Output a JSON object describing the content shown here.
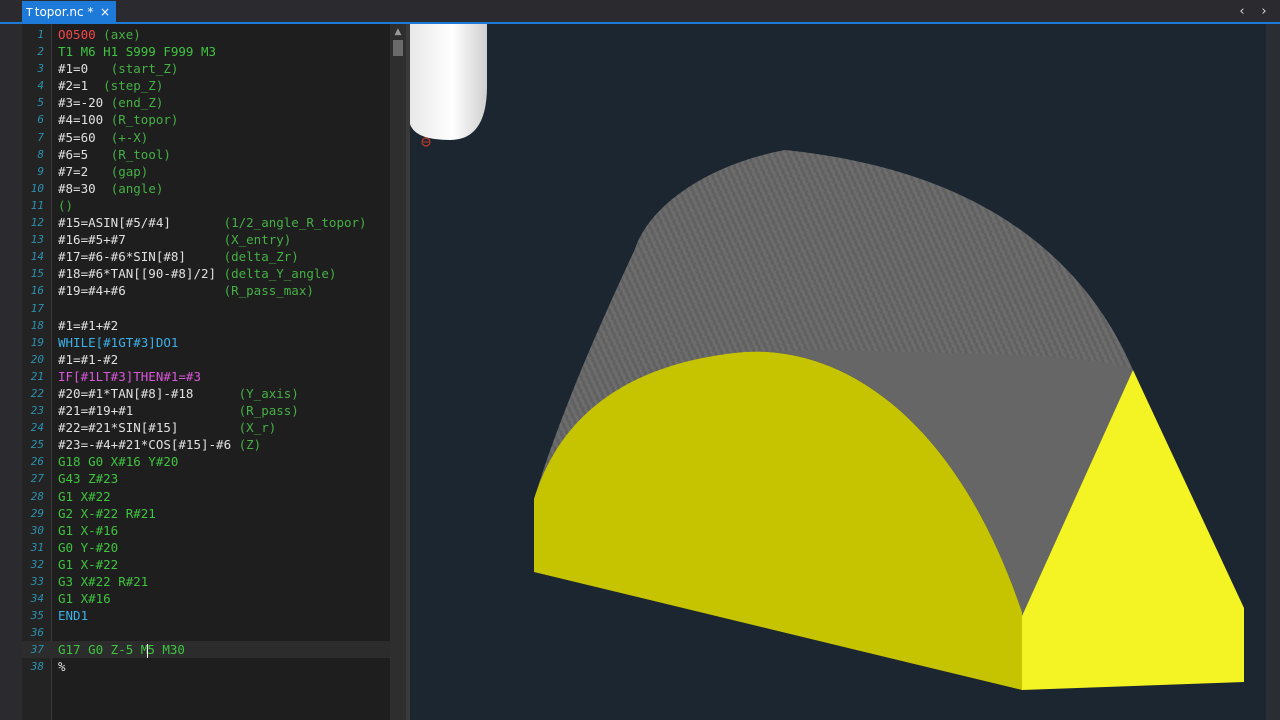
{
  "tab": {
    "title": "topor.nc *",
    "icon": "nc-file-icon",
    "close": "×"
  },
  "nav": {
    "prev": "‹",
    "next": "›"
  },
  "colors": {
    "accent": "#1e7ad8",
    "editor_bg": "#1e1e1e",
    "viewport_bg": "#1c2630",
    "solid_gray": "#6d6d6d",
    "solid_yellow": "#c6c400",
    "face_yellow": "#f4f424"
  },
  "editor": {
    "current_line": 37,
    "lines": [
      {
        "n": "1",
        "segs": [
          [
            "O0500",
            "red"
          ],
          [
            " (axe)",
            "comment"
          ]
        ]
      },
      {
        "n": "2",
        "segs": [
          [
            "T1 M6 H1 S999 F999 M3",
            "green"
          ]
        ]
      },
      {
        "n": "3",
        "segs": [
          [
            "#1=0   ",
            "white"
          ],
          [
            "(start_Z)",
            "comment"
          ]
        ]
      },
      {
        "n": "4",
        "segs": [
          [
            "#2=1  ",
            "white"
          ],
          [
            "(step_Z)",
            "comment"
          ]
        ]
      },
      {
        "n": "5",
        "segs": [
          [
            "#3=-20 ",
            "white"
          ],
          [
            "(end_Z)",
            "comment"
          ]
        ]
      },
      {
        "n": "6",
        "segs": [
          [
            "#4=100 ",
            "white"
          ],
          [
            "(R_topor)",
            "comment"
          ]
        ]
      },
      {
        "n": "7",
        "segs": [
          [
            "#5=60  ",
            "white"
          ],
          [
            "(+-X)",
            "comment"
          ]
        ]
      },
      {
        "n": "8",
        "segs": [
          [
            "#6=5   ",
            "white"
          ],
          [
            "(R_tool)",
            "comment"
          ]
        ]
      },
      {
        "n": "9",
        "segs": [
          [
            "#7=2   ",
            "white"
          ],
          [
            "(gap)",
            "comment"
          ]
        ]
      },
      {
        "n": "10",
        "segs": [
          [
            "#8=30  ",
            "white"
          ],
          [
            "(angle)",
            "comment"
          ]
        ]
      },
      {
        "n": "11",
        "segs": [
          [
            "()",
            "comment"
          ]
        ]
      },
      {
        "n": "12",
        "segs": [
          [
            "#15=ASIN[#5/#4]       ",
            "white"
          ],
          [
            "(1/2_angle_R_topor)",
            "comment"
          ]
        ]
      },
      {
        "n": "13",
        "segs": [
          [
            "#16=#5+#7             ",
            "white"
          ],
          [
            "(X_entry)",
            "comment"
          ]
        ]
      },
      {
        "n": "14",
        "segs": [
          [
            "#17=#6-#6*SIN[#8]     ",
            "white"
          ],
          [
            "(delta_Zr)",
            "comment"
          ]
        ]
      },
      {
        "n": "15",
        "segs": [
          [
            "#18=#6*TAN[[90-#8]/2] ",
            "white"
          ],
          [
            "(delta_Y_angle)",
            "comment"
          ]
        ]
      },
      {
        "n": "16",
        "segs": [
          [
            "#19=#4+#6             ",
            "white"
          ],
          [
            "(R_pass_max)",
            "comment"
          ]
        ]
      },
      {
        "n": "17",
        "segs": []
      },
      {
        "n": "18",
        "segs": [
          [
            "#1=#1+#2",
            "white"
          ]
        ]
      },
      {
        "n": "19",
        "segs": [
          [
            "WHILE[#1GT#3]DO1",
            "cyan"
          ]
        ]
      },
      {
        "n": "20",
        "segs": [
          [
            "#1=#1-#2",
            "white"
          ]
        ]
      },
      {
        "n": "21",
        "segs": [
          [
            "IF[#1LT#3]THEN#1=#3",
            "magenta"
          ]
        ]
      },
      {
        "n": "22",
        "segs": [
          [
            "#20=#1*TAN[#8]-#18      ",
            "white"
          ],
          [
            "(Y_axis)",
            "comment"
          ]
        ]
      },
      {
        "n": "23",
        "segs": [
          [
            "#21=#19+#1              ",
            "white"
          ],
          [
            "(R_pass)",
            "comment"
          ]
        ]
      },
      {
        "n": "24",
        "segs": [
          [
            "#22=#21*SIN[#15]        ",
            "white"
          ],
          [
            "(X_r)",
            "comment"
          ]
        ]
      },
      {
        "n": "25",
        "segs": [
          [
            "#23=-#4+#21*COS[#15]-#6 ",
            "white"
          ],
          [
            "(Z)",
            "comment"
          ]
        ]
      },
      {
        "n": "26",
        "segs": [
          [
            "G18 G0 X#16 Y#20",
            "green"
          ]
        ]
      },
      {
        "n": "27",
        "segs": [
          [
            "G43 Z#23",
            "green"
          ]
        ]
      },
      {
        "n": "28",
        "segs": [
          [
            "G1 X#22",
            "green"
          ]
        ]
      },
      {
        "n": "29",
        "segs": [
          [
            "G2 X-#22 R#21",
            "green"
          ]
        ]
      },
      {
        "n": "30",
        "segs": [
          [
            "G1 X-#16",
            "green"
          ]
        ]
      },
      {
        "n": "31",
        "segs": [
          [
            "G0 Y-#20",
            "green"
          ]
        ]
      },
      {
        "n": "32",
        "segs": [
          [
            "G1 X-#22",
            "green"
          ]
        ]
      },
      {
        "n": "33",
        "segs": [
          [
            "G3 X#22 R#21",
            "green"
          ]
        ]
      },
      {
        "n": "34",
        "segs": [
          [
            "G1 X#16",
            "green"
          ]
        ]
      },
      {
        "n": "35",
        "segs": [
          [
            "END1",
            "cyan"
          ]
        ]
      },
      {
        "n": "36",
        "segs": []
      },
      {
        "n": "37",
        "segs": [
          [
            "G17 G0 Z-5 M",
            "green"
          ],
          [
            "|",
            "caret"
          ],
          [
            "5 M30",
            "green"
          ]
        ]
      },
      {
        "n": "38",
        "segs": [
          [
            "%",
            "white"
          ]
        ]
      }
    ]
  }
}
